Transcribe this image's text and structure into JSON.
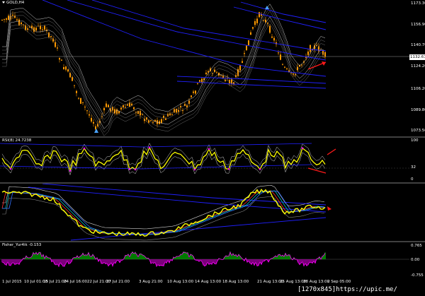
{
  "main": {
    "title": "GOLD,H4",
    "last_price": "1132.67",
    "axis_labels": [
      "1173.30",
      "1156.90",
      "1140.70",
      "1124.20",
      "1106.20",
      "1089.80",
      "1073.50"
    ],
    "axis_values": [
      1173.3,
      1156.9,
      1140.7,
      1124.2,
      1106.2,
      1089.8,
      1073.5
    ],
    "fill_color": "#ff9900",
    "band_color": "#2020ff",
    "envelope_color": "#cfcfcf",
    "arrow_color": "#ff1a1a"
  },
  "rsi": {
    "title": "RSI(8) 24.7238",
    "axis_labels": [
      "100",
      "32",
      "0"
    ],
    "line_color": "#ffff00",
    "dot_color": "#ff00ff"
  },
  "mid": {
    "line_color": "#ffff00",
    "band_color": "#2020ff"
  },
  "fisher": {
    "title": "Fisher_Yur4ik -0.153",
    "axis_labels": [
      "0.765",
      "0.00",
      "-0.755"
    ],
    "positive_color": "#00cc00",
    "negative_color": "#cc00cc"
  },
  "time_labels": [
    "1 Jul 2015",
    "10 Jul 01:00",
    "15 Jul 21:00",
    "24 Jul 16:00",
    "22 Jul 21:00",
    "27 Jul 21:00",
    "3 Aug 21:00",
    "10 Aug 13:00",
    "14 Aug 13:00",
    "18 Aug 13:00",
    "21 Aug 13:00",
    "25 Aug 13:00",
    "28 Aug 13:00",
    "2 Sep 05:00"
  ],
  "watermark": "[1270x845]https://upic.me/"
}
